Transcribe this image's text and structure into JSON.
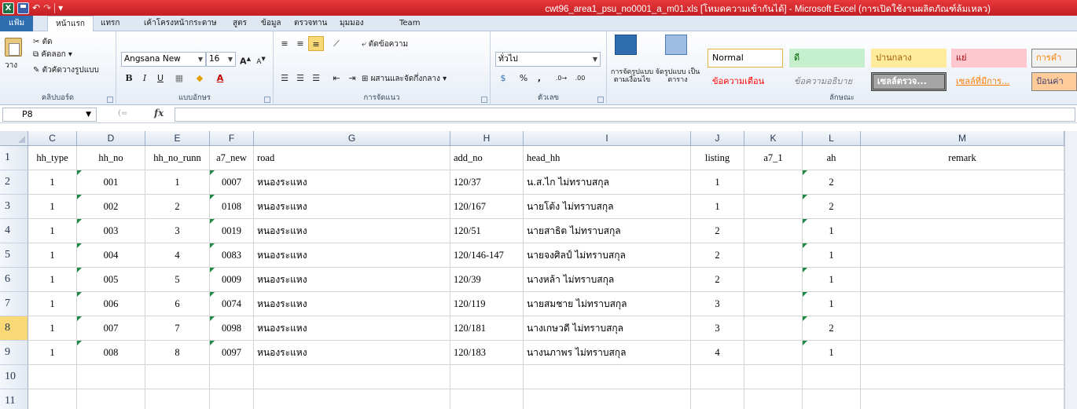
{
  "window": {
    "title": "cwt96_area1_psu_no0001_a_m01.xls  [โหมดความเข้ากันได้]  -  Microsoft Excel (การเปิดใช้งานผลิตภัณฑ์ล้มเหลว)"
  },
  "tabs": [
    "แฟ้ม",
    "หน้าแรก",
    "แทรก",
    "เค้าโครงหน้ากระดาษ",
    "สูตร",
    "ข้อมูล",
    "ตรวจทาน",
    "มุมมอง",
    "Team"
  ],
  "ribbon": {
    "clipboard": {
      "paste": "วาง",
      "cut": "ตัด",
      "copy": "คัดลอก",
      "format_painter": "ตัวคัดวางรูปแบบ",
      "group_label": "คลิปบอร์ด"
    },
    "font": {
      "name": "Angsana New",
      "size": "16",
      "group_label": "แบบอักษร"
    },
    "alignment": {
      "wrap_text": "ตัดข้อความ",
      "merge_center": "ผสานและจัดกึ่งกลาง",
      "group_label": "การจัดแนว"
    },
    "number": {
      "format": "ทั่วไป",
      "group_label": "ตัวเลข"
    },
    "styles": {
      "conditional_formatting": "การจัดรูปแบบ ตามเงื่อนไข",
      "format_as_table": "จัดรูปแบบ เป็นตาราง",
      "normal": "Normal",
      "good": "ดี",
      "neutral": "ปานกลาง",
      "bad": "แย่",
      "calculation": "การคำ",
      "warning_text": "ข้อความเตือน",
      "explanatory_text": "ข้อความอธิบาย",
      "check_cell": "เซลล์ตรวจ...",
      "linked_cell": "เซลล์ที่มีการ...",
      "input": "ป้อนค่า",
      "group_label": "ลักษณะ",
      "colors": {
        "good_bg": "#c6efce",
        "neutral_bg": "#ffeb9c",
        "bad_bg": "#ffc7ce",
        "check_bg": "#a5a5a5"
      }
    }
  },
  "formula_bar": {
    "name_box": "P8",
    "fx": "fx",
    "formula": ""
  },
  "columns": [
    {
      "letter": "C"
    },
    {
      "letter": "D"
    },
    {
      "letter": "E"
    },
    {
      "letter": "F"
    },
    {
      "letter": "G"
    },
    {
      "letter": "H"
    },
    {
      "letter": "I"
    },
    {
      "letter": "J"
    },
    {
      "letter": "K"
    },
    {
      "letter": "L"
    },
    {
      "letter": "M"
    }
  ],
  "row_numbers": [
    "1",
    "2",
    "3",
    "4",
    "5",
    "6",
    "7",
    "8",
    "9",
    "10",
    "11"
  ],
  "selected_row": "8",
  "header_row": [
    "hh_type",
    "hh_no",
    "hh_no_runn",
    "a7_new",
    "road",
    "add_no",
    "head_hh",
    "listing",
    "a7_1",
    "ah",
    "remark"
  ],
  "rows": [
    [
      "1",
      "001",
      "1",
      "0007",
      "หนองระแหง",
      "120/37",
      "น.ส.ไก ไม่ทราบสกุล",
      "1",
      "",
      "2",
      ""
    ],
    [
      "1",
      "002",
      "2",
      "0108",
      "หนองระแหง",
      "120/167",
      "นายโต้ง ไม่ทราบสกุล",
      "1",
      "",
      "2",
      ""
    ],
    [
      "1",
      "003",
      "3",
      "0019",
      "หนองระแหง",
      "120/51",
      "นายสาธิต ไม่ทราบสกุล",
      "2",
      "",
      "1",
      ""
    ],
    [
      "1",
      "004",
      "4",
      "0083",
      "หนองระแหง",
      "120/146-147",
      "นายจงศิลป์ ไม่ทราบสกุล",
      "2",
      "",
      "1",
      ""
    ],
    [
      "1",
      "005",
      "5",
      "0009",
      "หนองระแหง",
      "120/39",
      "นางหล้า ไม่ทราบสกุล",
      "2",
      "",
      "1",
      ""
    ],
    [
      "1",
      "006",
      "6",
      "0074",
      "หนองระแหง",
      "120/119",
      "นายสมชาย ไม่ทราบสกุล",
      "3",
      "",
      "1",
      ""
    ],
    [
      "1",
      "007",
      "7",
      "0098",
      "หนองระแหง",
      "120/181",
      "นางเกษวดี ไม่ทราบสกุล",
      "3",
      "",
      "2",
      ""
    ],
    [
      "1",
      "008",
      "8",
      "0097",
      "หนองระแหง",
      "120/183",
      "นางนภาพร ไม่ทราบสกุล",
      "4",
      "",
      "1",
      ""
    ]
  ]
}
